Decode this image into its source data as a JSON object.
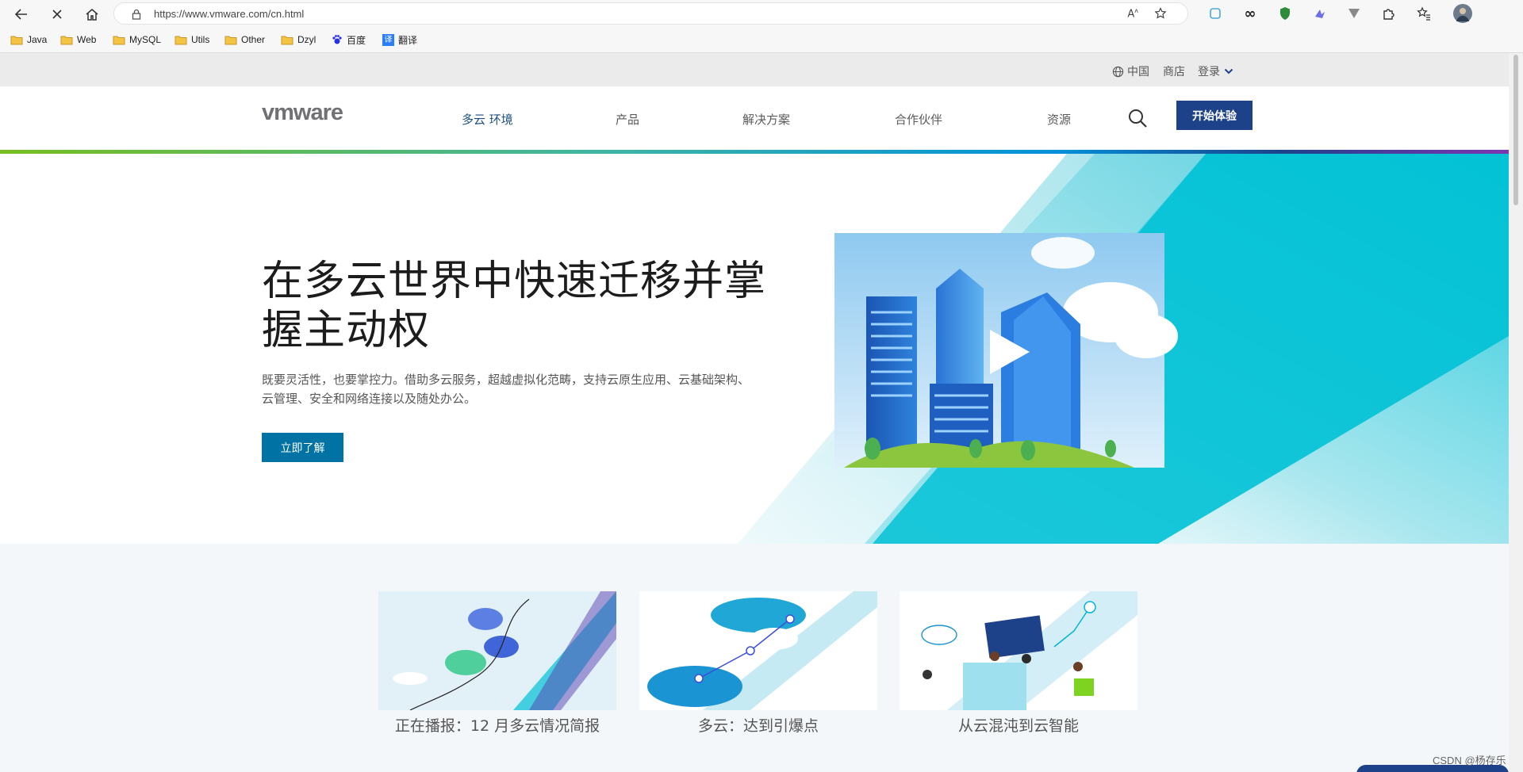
{
  "browser": {
    "url": "https://www.vmware.com/cn.html",
    "bookmarks": [
      {
        "label": "Java",
        "type": "folder"
      },
      {
        "label": "Web",
        "type": "folder"
      },
      {
        "label": "MySQL",
        "type": "folder"
      },
      {
        "label": "Utils",
        "type": "folder"
      },
      {
        "label": "Other",
        "type": "folder"
      },
      {
        "label": "Dzyl",
        "type": "folder"
      },
      {
        "label": "百度",
        "type": "link"
      },
      {
        "label": "翻译",
        "type": "link"
      }
    ]
  },
  "utility": {
    "region": "中国",
    "store": "商店",
    "login": "登录"
  },
  "header": {
    "logo": "vmware",
    "nav": [
      "多云 环境",
      "产品",
      "解决方案",
      "合作伙伴",
      "资源"
    ],
    "cta": "开始体验"
  },
  "hero": {
    "title": "在多云世界中快速迁移并掌握主动权",
    "subtitle": "既要灵活性，也要掌控力。借助多云服务，超越虚拟化范畴，支持云原生应用、云基础架构、云管理、安全和网络连接以及随处办公。",
    "button": "立即了解"
  },
  "cards": [
    {
      "title": "正在播报：12 月多云情况简报"
    },
    {
      "title": "多云：达到引爆点"
    },
    {
      "title": "从云混沌到云智能"
    }
  ],
  "watermark": "CSDN @杨存乐",
  "colors": {
    "brand_blue": "#1d428a",
    "button_blue": "#0072a3",
    "teal": "#00c1d5"
  }
}
